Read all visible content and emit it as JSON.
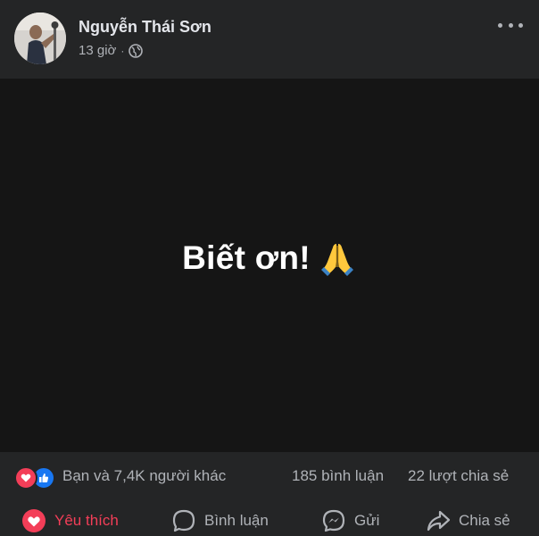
{
  "post": {
    "author": "Nguyễn Thái Sơn",
    "time": "13 giờ",
    "separator": "·",
    "privacy_icon": "globe-icon",
    "content_text": "Biết ơn!",
    "content_emoji": "folded-hands-icon"
  },
  "summary": {
    "reactions": [
      "love-reaction-icon",
      "like-reaction-icon"
    ],
    "reactions_text": "Bạn và 7,4K người khác",
    "comments": "185 bình luận",
    "shares": "22 lượt chia sẻ"
  },
  "actions": {
    "love_label": "Yêu thích",
    "comment_label": "Bình luận",
    "send_label": "Gửi",
    "share_label": "Chia sẻ"
  },
  "colors": {
    "background": "#242526",
    "content_bg": "#151515",
    "love": "#f33e58",
    "like": "#1877f2",
    "text_secondary": "#b0b3b8"
  }
}
